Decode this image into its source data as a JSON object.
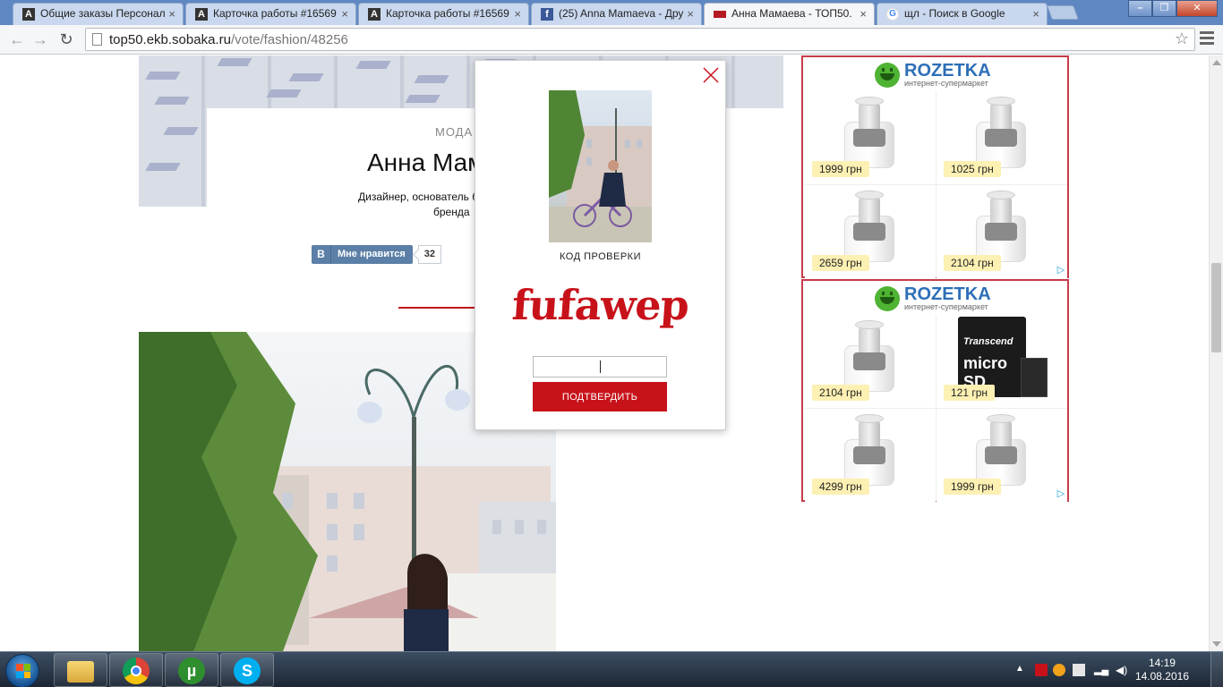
{
  "browser": {
    "tabs": [
      {
        "title": "Общие заказы Персонал",
        "favicon": "a-icon",
        "active": false
      },
      {
        "title": "Карточка работы #16569",
        "favicon": "a-icon",
        "active": false
      },
      {
        "title": "Карточка работы #16569",
        "favicon": "a-icon",
        "active": false
      },
      {
        "title": "(25) Anna Mamaeva - Дру",
        "favicon": "facebook-icon",
        "active": false
      },
      {
        "title": "Анна Мамаева - ТОП50.",
        "favicon": "sobaka-icon",
        "active": true
      },
      {
        "title": "щл - Поиск в Google",
        "favicon": "google-icon",
        "active": false
      }
    ],
    "tab_close_glyph": "×",
    "url_host": "top50.ekb.sobaka.ru",
    "url_path": "/vote/fashion/48256"
  },
  "page": {
    "category": "МОДА",
    "person_name": "Анна Мамаева",
    "description_line1": "Дизайнер, основатель бренда",
    "description_line2": "бренда",
    "like_button": {
      "logo": "В",
      "label": "Мне нравится",
      "count": "32"
    }
  },
  "modal": {
    "code_label": "КОД ПРОВЕРКИ",
    "captcha": "fufawep",
    "input_value": "",
    "confirm_label": "ПОДТВЕРДИТЬ"
  },
  "ads": [
    {
      "brand": "ROZETKA",
      "tagline": "интернет-супермаркет",
      "products": [
        {
          "price": "1999 грн",
          "kind": "grinder"
        },
        {
          "price": "1025 грн",
          "kind": "grinder"
        },
        {
          "price": "2659 грн",
          "kind": "grinder"
        },
        {
          "price": "2104 грн",
          "kind": "grinder"
        }
      ]
    },
    {
      "brand": "ROZETKA",
      "tagline": "интернет-супермаркет",
      "products": [
        {
          "price": "2104 грн",
          "kind": "grinder"
        },
        {
          "price": "121 грн",
          "kind": "sdcard",
          "label1": "Transcend",
          "label2": "micro SD"
        },
        {
          "price": "4299 грн",
          "kind": "grinder"
        },
        {
          "price": "1999 грн",
          "kind": "grinder"
        }
      ]
    }
  ],
  "taskbar": {
    "apps": [
      "explorer-icon",
      "chrome-icon",
      "utorrent-icon",
      "skype-icon"
    ],
    "time": "14:19",
    "date": "14.08.2016"
  },
  "colors": {
    "accent_red": "#c8121a",
    "ad_border": "#c63c4b",
    "vk_blue": "#5b7fa6",
    "rozetka_blue": "#2e6fb7"
  }
}
